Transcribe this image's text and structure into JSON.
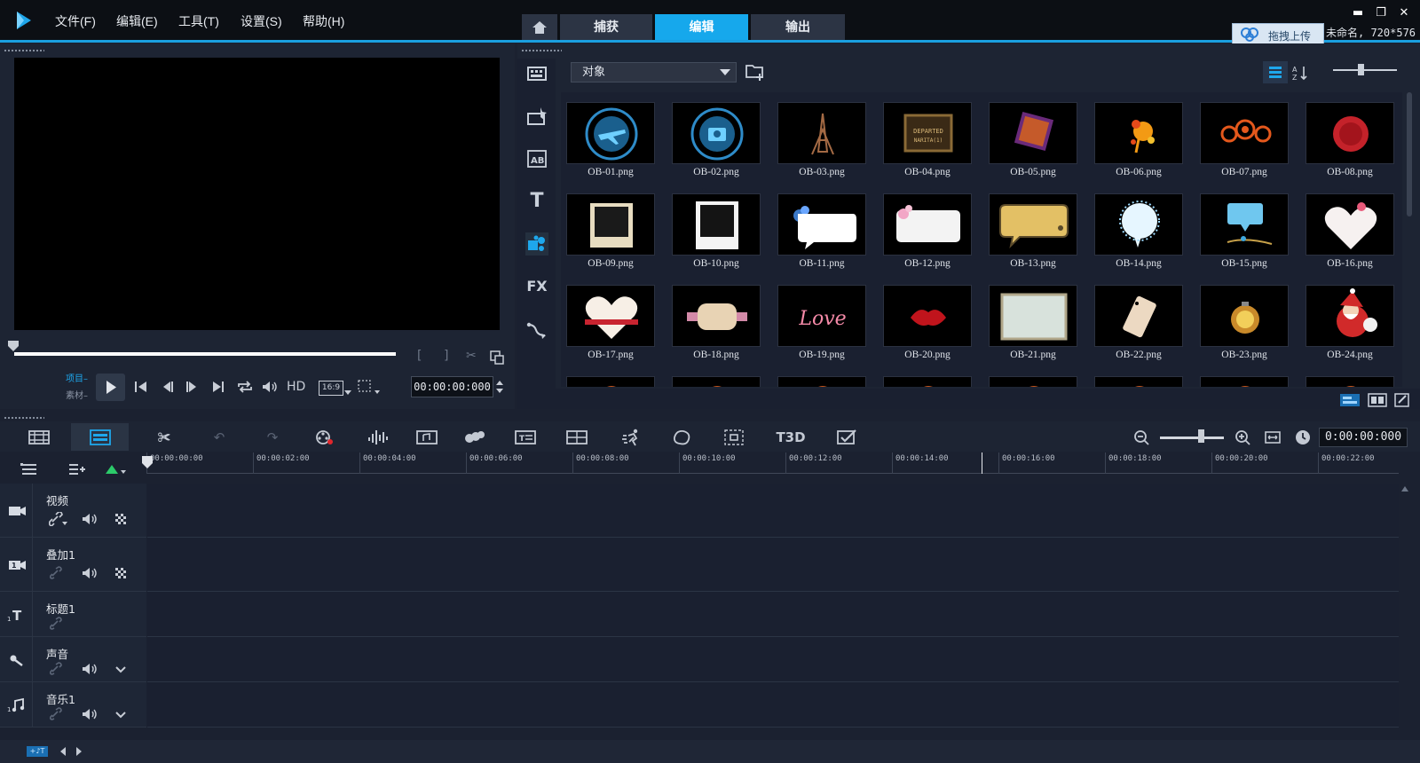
{
  "menu": {
    "file": "文件(F)",
    "edit": "编辑(E)",
    "tools": "工具(T)",
    "settings": "设置(S)",
    "help": "帮助(H)"
  },
  "mode_tabs": {
    "capture": "捕获",
    "edit": "编辑",
    "output": "输出",
    "active": "编辑"
  },
  "cloud": {
    "upload_label": "拖拽上传"
  },
  "project_info": "未命名, 720*576",
  "player": {
    "project_label": "项目–",
    "clip_label": "素材–",
    "hd_label": "HD",
    "aspect_label": "16:9",
    "timecode": "00:00:00:000"
  },
  "library": {
    "category": "对象",
    "sidebar_fx": "FX",
    "items": [
      {
        "name": "OB-01.png"
      },
      {
        "name": "OB-02.png"
      },
      {
        "name": "OB-03.png"
      },
      {
        "name": "OB-04.png"
      },
      {
        "name": "OB-05.png"
      },
      {
        "name": "OB-06.png"
      },
      {
        "name": "OB-07.png"
      },
      {
        "name": "OB-08.png"
      },
      {
        "name": "OB-09.png"
      },
      {
        "name": "OB-10.png"
      },
      {
        "name": "OB-11.png"
      },
      {
        "name": "OB-12.png"
      },
      {
        "name": "OB-13.png"
      },
      {
        "name": "OB-14.png"
      },
      {
        "name": "OB-15.png"
      },
      {
        "name": "OB-16.png"
      },
      {
        "name": "OB-17.png"
      },
      {
        "name": "OB-18.png"
      },
      {
        "name": "OB-19.png"
      },
      {
        "name": "OB-20.png"
      },
      {
        "name": "OB-21.png"
      },
      {
        "name": "OB-22.png"
      },
      {
        "name": "OB-23.png"
      },
      {
        "name": "OB-24.png"
      }
    ]
  },
  "timeline": {
    "timecode": "0:00:00:000",
    "title_3d_label": "T3D",
    "ruler": [
      "00:00:00:00",
      "00:00:02:00",
      "00:00:04:00",
      "00:00:06:00",
      "00:00:08:00",
      "00:00:10:00",
      "00:00:12:00",
      "00:00:14:00",
      "00:00:16:00",
      "00:00:18:00",
      "00:00:20:00",
      "00:00:22:00"
    ],
    "tracks": [
      {
        "name": "视频"
      },
      {
        "name": "叠加1"
      },
      {
        "name": "标题1"
      },
      {
        "name": "声音"
      },
      {
        "name": "音乐1"
      }
    ]
  },
  "colors": {
    "accent": "#16a8ec",
    "background": "#1b2130",
    "panel": "#1d2433"
  }
}
